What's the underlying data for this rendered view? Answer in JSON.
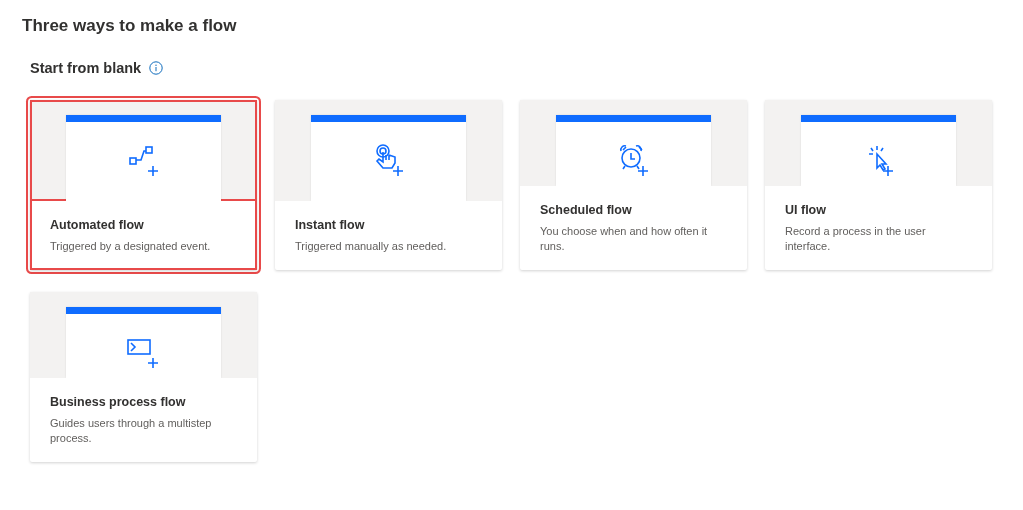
{
  "page_title": "Three ways to make a flow",
  "section": {
    "title": "Start from blank",
    "info": true
  },
  "cards": [
    {
      "kind": "automated",
      "title": "Automated flow",
      "description": "Triggered by a designated event.",
      "selected": true
    },
    {
      "kind": "instant",
      "title": "Instant flow",
      "description": "Triggered manually as needed.",
      "selected": false
    },
    {
      "kind": "scheduled",
      "title": "Scheduled flow",
      "description": "You choose when and how often it runs.",
      "selected": false
    },
    {
      "kind": "ui",
      "title": "UI flow",
      "description": "Record a process in the user interface.",
      "selected": false
    },
    {
      "kind": "business",
      "title": "Business process flow",
      "description": "Guides users through a multistep process.",
      "selected": false
    }
  ]
}
